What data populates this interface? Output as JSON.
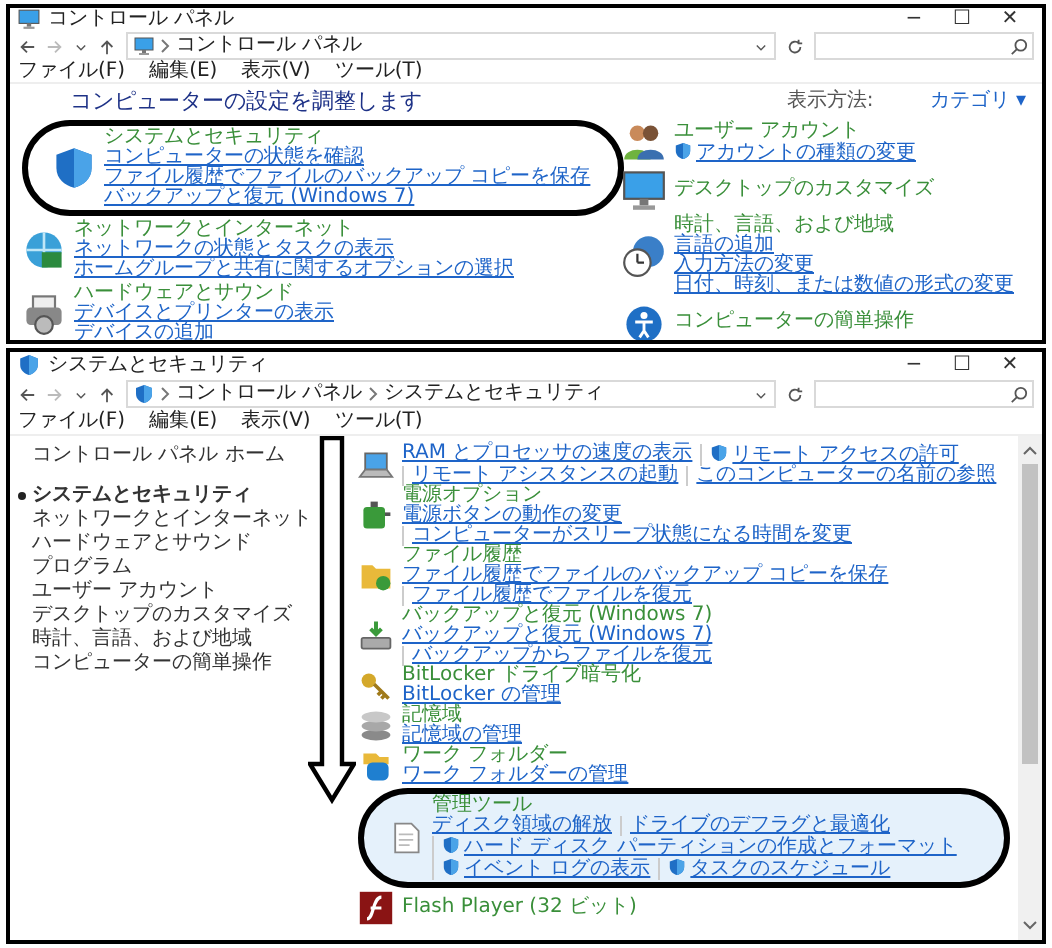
{
  "control_panel_window": {
    "title": "コントロール パネル",
    "window_buttons": [
      "−",
      "☐",
      "✕"
    ],
    "breadcrumb": [
      "コントロール パネル"
    ],
    "menu": [
      "ファイル(F)",
      "編集(E)",
      "表示(V)",
      "ツール(T)"
    ],
    "heading": "コンピューターの設定を調整します",
    "view_by": {
      "label": "表示方法:",
      "value": "カテゴリ ▾"
    },
    "left_categories": [
      {
        "title": "システムとセキュリティ",
        "circled": true,
        "links": [
          {
            "text": "コンピューターの状態を確認",
            "shield": false
          },
          {
            "text": "ファイル履歴でファイルのバックアップ コピーを保存",
            "shield": false
          },
          {
            "text": "バックアップと復元 (Windows 7)",
            "shield": false
          }
        ]
      },
      {
        "title": "ネットワークとインターネット",
        "circled": false,
        "links": [
          {
            "text": "ネットワークの状態とタスクの表示",
            "shield": false
          },
          {
            "text": "ホームグループと共有に関するオプションの選択",
            "shield": false
          }
        ]
      },
      {
        "title": "ハードウェアとサウンド",
        "circled": false,
        "links": [
          {
            "text": "デバイスとプリンターの表示",
            "shield": false
          },
          {
            "text": "デバイスの追加",
            "shield": false
          }
        ]
      }
    ],
    "right_categories": [
      {
        "title": "ユーザー アカウント",
        "circled": false,
        "links": [
          {
            "text": "アカウントの種類の変更",
            "shield": true
          }
        ]
      },
      {
        "title": "デスクトップのカスタマイズ",
        "circled": false
      },
      {
        "title": "時計、言語、および地域",
        "circled": false,
        "links": [
          {
            "text": "言語の追加",
            "shield": false
          },
          {
            "text": "入力方法の変更",
            "shield": false
          },
          {
            "text": "日付、時刻、または数値の形式の変更",
            "shield": false
          }
        ]
      },
      {
        "title": "コンピューターの簡単操作",
        "circled": false
      }
    ]
  },
  "system_security_window": {
    "title": "システムとセキュリティ",
    "window_buttons": [
      "−",
      "☐",
      "✕"
    ],
    "breadcrumb": [
      "コントロール パネル",
      "システムとセキュリティ"
    ],
    "menu": [
      "ファイル(F)",
      "編集(E)",
      "表示(V)",
      "ツール(T)"
    ],
    "sidebar": [
      {
        "text": "コントロール パネル ホーム",
        "selected": false
      },
      {
        "text": "システムとセキュリティ",
        "selected": true
      },
      {
        "text": "ネットワークとインターネット",
        "selected": false
      },
      {
        "text": "ハードウェアとサウンド",
        "selected": false
      },
      {
        "text": "プログラム",
        "selected": false
      },
      {
        "text": "ユーザー アカウント",
        "selected": false
      },
      {
        "text": "デスクトップのカスタマイズ",
        "selected": false
      },
      {
        "text": "時計、言語、および地域",
        "selected": false
      },
      {
        "text": "コンピューターの簡単操作",
        "selected": false
      }
    ],
    "items": [
      {
        "circled": false,
        "highlighted": false,
        "links": [
          {
            "text": "RAM とプロセッサの速度の表示",
            "shield": false
          },
          {
            "text": "リモート アクセスの許可",
            "shield": true
          },
          {
            "text": "リモート アシスタンスの起動",
            "shield": false
          },
          {
            "text": "このコンピューターの名前の参照",
            "shield": false
          }
        ]
      },
      {
        "title": "電源オプション",
        "circled": false,
        "highlighted": false,
        "links": [
          {
            "text": "電源ボタンの動作の変更",
            "shield": false
          },
          {
            "text": "コンピューターがスリープ状態になる時間を変更",
            "shield": false
          }
        ]
      },
      {
        "title": "ファイル履歴",
        "circled": false,
        "highlighted": false,
        "links": [
          {
            "text": "ファイル履歴でファイルのバックアップ コピーを保存",
            "shield": false
          },
          {
            "text": "ファイル履歴でファイルを復元",
            "shield": false
          }
        ]
      },
      {
        "title": "バックアップと復元 (Windows 7)",
        "circled": false,
        "highlighted": false,
        "links": [
          {
            "text": "バックアップと復元 (Windows 7)",
            "shield": false
          },
          {
            "text": "バックアップからファイルを復元",
            "shield": false
          }
        ]
      },
      {
        "title": "BitLocker ドライブ暗号化",
        "circled": false,
        "highlighted": false,
        "links": [
          {
            "text": "BitLocker の管理",
            "shield": false
          }
        ]
      },
      {
        "title": "記憶域",
        "circled": false,
        "highlighted": false,
        "links": [
          {
            "text": "記憶域の管理",
            "shield": false
          }
        ]
      },
      {
        "title": "ワーク フォルダー",
        "circled": false,
        "highlighted": false,
        "links": [
          {
            "text": "ワーク フォルダーの管理",
            "shield": false
          }
        ]
      },
      {
        "title": "管理ツール",
        "circled": true,
        "highlighted": true,
        "links": [
          {
            "text": "ディスク領域の解放",
            "shield": false
          },
          {
            "text": "ドライブのデフラグと最適化",
            "shield": false
          },
          {
            "text": "ハード ディスク パーティションの作成とフォーマット",
            "shield": true
          },
          {
            "text": "イベント ログの表示",
            "shield": true
          },
          {
            "text": "タスクのスケジュール",
            "shield": true
          }
        ]
      },
      {
        "title": "Flash Player (32 ビット)",
        "circled": false,
        "highlighted": false
      }
    ]
  }
}
